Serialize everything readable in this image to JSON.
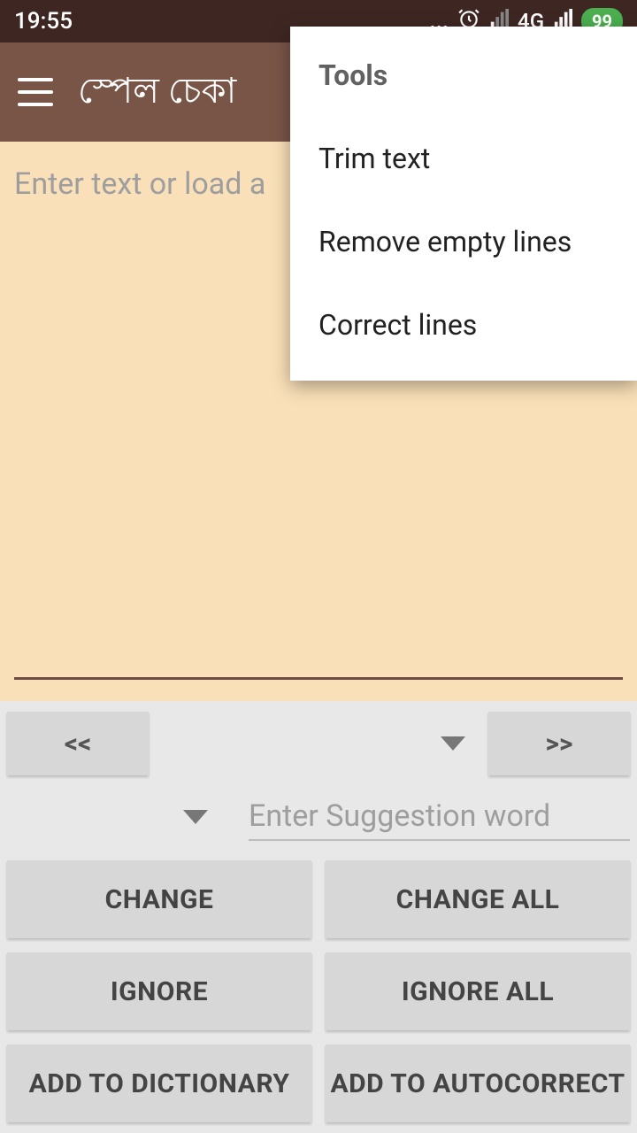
{
  "status": {
    "time": "19:55",
    "dots": "...",
    "network": "4G",
    "battery": "99"
  },
  "appbar": {
    "title": "স্পেল চেকা"
  },
  "editor": {
    "placeholder": "Enter text or load a"
  },
  "menu": {
    "header": "Tools",
    "items": [
      "Trim text",
      "Remove empty lines",
      "Correct lines"
    ]
  },
  "nav": {
    "prev": "<<",
    "next": ">>"
  },
  "suggestion": {
    "placeholder": "Enter Suggestion word"
  },
  "buttons": {
    "change": "CHANGE",
    "change_all": "CHANGE ALL",
    "ignore": "IGNORE",
    "ignore_all": "IGNORE ALL",
    "add_dict": "ADD TO DICTIONARY",
    "add_auto": "ADD TO AUTOCORRECT"
  }
}
